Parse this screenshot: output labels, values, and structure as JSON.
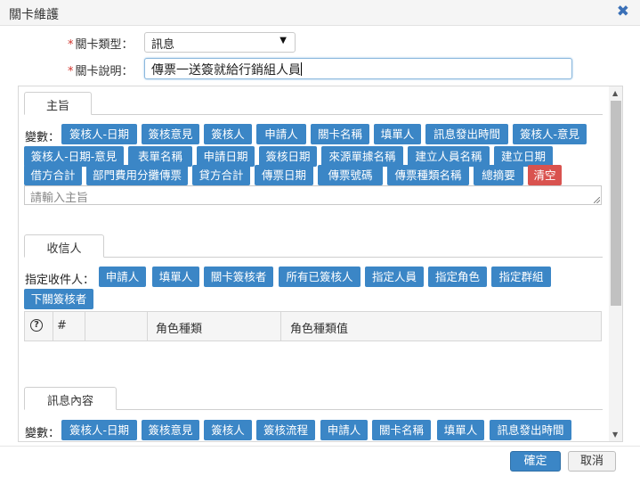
{
  "dialog": {
    "title": "關卡維護"
  },
  "form": {
    "type_label": "關卡類型：",
    "type_value": "訊息",
    "desc_label": "關卡說明：",
    "desc_value": "傳票一送簽就給行銷組人員"
  },
  "subject": {
    "tab": "主旨",
    "var_label": "變數：",
    "buttons": [
      "簽核人-日期",
      "簽核意見",
      "簽核人",
      "申請人",
      "關卡名稱",
      "填單人",
      "訊息發出時間",
      "簽核人-意見",
      "簽核人-日期-意見",
      "表單名稱",
      "申請日期",
      "簽核日期",
      "來源單據名稱",
      "建立人員名稱",
      "建立日期",
      "借方合計",
      "部門費用分攤傳票",
      "貸方合計",
      "傳票日期",
      "傳票號碼",
      "傳票種類名稱",
      "總摘要",
      "清空"
    ],
    "placeholder": "請輸入主旨"
  },
  "recipient": {
    "tab": "收信人",
    "label": "指定收件人：",
    "buttons": [
      "申請人",
      "填單人",
      "關卡簽核者",
      "所有已簽核人",
      "指定人員",
      "指定角色",
      "指定群組",
      "下關簽核者"
    ],
    "table_headers": [
      "#",
      "角色種類",
      "角色種類值"
    ]
  },
  "message": {
    "tab": "訊息內容",
    "var_label": "變數：",
    "buttons": [
      "簽核人-日期",
      "簽核意見",
      "簽核人",
      "簽核流程",
      "申請人",
      "關卡名稱",
      "填單人",
      "訊息發出時間"
    ]
  },
  "footer": {
    "ok": "確定",
    "cancel": "取消"
  },
  "icons": {
    "close": "close-icon",
    "help": "help-icon"
  },
  "colors": {
    "primary": "#3b86c6",
    "danger": "#d9534f"
  }
}
